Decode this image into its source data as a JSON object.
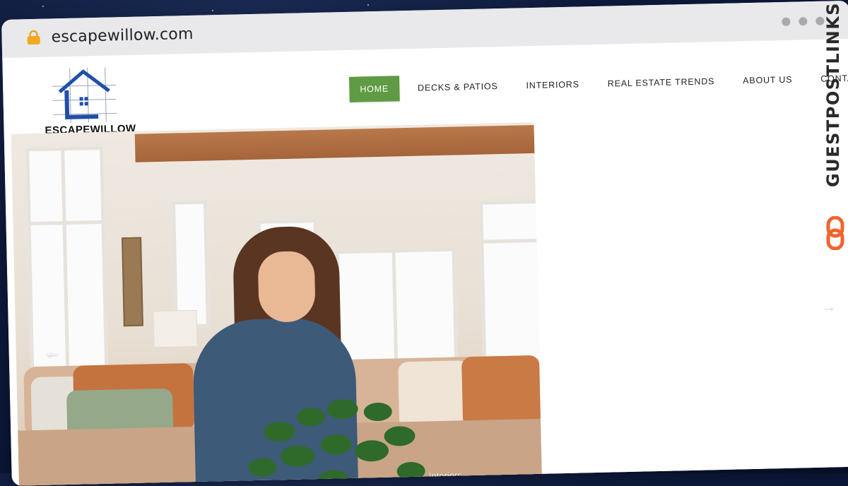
{
  "browser": {
    "url": "escapewillow.com"
  },
  "site": {
    "logo_text": "ESCAPEWILLOW",
    "nav": [
      {
        "label": "HOME",
        "active": true
      },
      {
        "label": "DECKS & PATIOS",
        "active": false
      },
      {
        "label": "INTERIORS",
        "active": false
      },
      {
        "label": "REAL ESTATE TRENDS",
        "active": false
      },
      {
        "label": "ABOUT US",
        "active": false
      },
      {
        "label": "CONTACT",
        "active": false
      }
    ],
    "hero": {
      "caption": "Interiors",
      "prev_icon": "arrow-left-icon",
      "next_icon": "arrow-right-icon"
    }
  },
  "badge": {
    "text": "GUESTPOSTLINKS",
    "icon": "link-icon"
  },
  "colors": {
    "accent": "#5e9b43",
    "logo_blue": "#1f4fa8",
    "badge_orange": "#f0642e",
    "background": "#0d1a3c"
  }
}
